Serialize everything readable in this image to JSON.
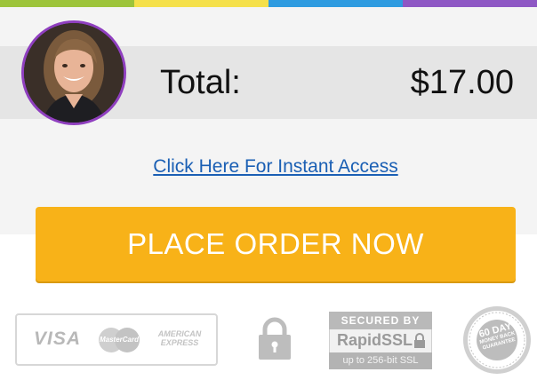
{
  "accent_colors": [
    "#9dc43a",
    "#f5e04a",
    "#2e9be0",
    "#8e57c4",
    "#d54a7a"
  ],
  "order": {
    "total_label": "Total:",
    "total_amount": "$17.00"
  },
  "access_link": "Click Here For Instant Access",
  "order_button": "PLACE ORDER NOW",
  "badges": {
    "visa": "VISA",
    "mastercard": "MasterCard",
    "amex_line1": "AMERICAN",
    "amex_line2": "EXPRESS",
    "ssl_top": "SECURED BY",
    "ssl_brand": "RapidSSL",
    "ssl_bottom": "up to 256-bit SSL",
    "guarantee_line1": "60 DAY",
    "guarantee_line2": "MONEY BACK",
    "guarantee_line3": "GUARANTEE"
  },
  "icons": [
    "avatar",
    "lock-icon",
    "rapidssl-lock-icon",
    "guarantee-seal"
  ]
}
